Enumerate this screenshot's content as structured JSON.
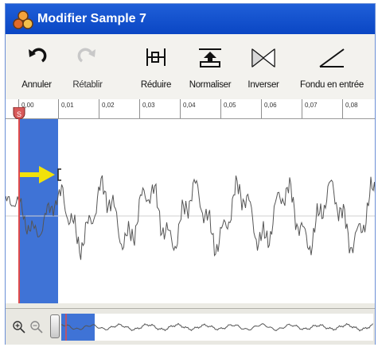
{
  "window": {
    "title": "Modifier Sample 7"
  },
  "toolbar": {
    "tools": [
      {
        "label": "Annuler",
        "icon": "undo-icon",
        "enabled": true
      },
      {
        "label": "Rétablir",
        "icon": "redo-icon",
        "enabled": false
      },
      {
        "label": "Réduire",
        "icon": "trim-icon",
        "enabled": true
      },
      {
        "label": "Normaliser",
        "icon": "normalize-icon",
        "enabled": true
      },
      {
        "label": "Inverser",
        "icon": "reverse-icon",
        "enabled": true
      },
      {
        "label": "Fondu en entrée",
        "icon": "fade-in-icon",
        "enabled": true
      }
    ]
  },
  "ruler": {
    "ticks": [
      "0,00",
      "0,01",
      "0,02",
      "0,03",
      "0,04",
      "0,05",
      "0,06",
      "0,07",
      "0,08"
    ],
    "start_marker": "S"
  },
  "colors": {
    "titlebar": "#0a46c4",
    "selection": "#3f73d6",
    "playhead": "#e04a4a",
    "marker_arrow": "#f2e20a",
    "waveform": "#555555"
  }
}
